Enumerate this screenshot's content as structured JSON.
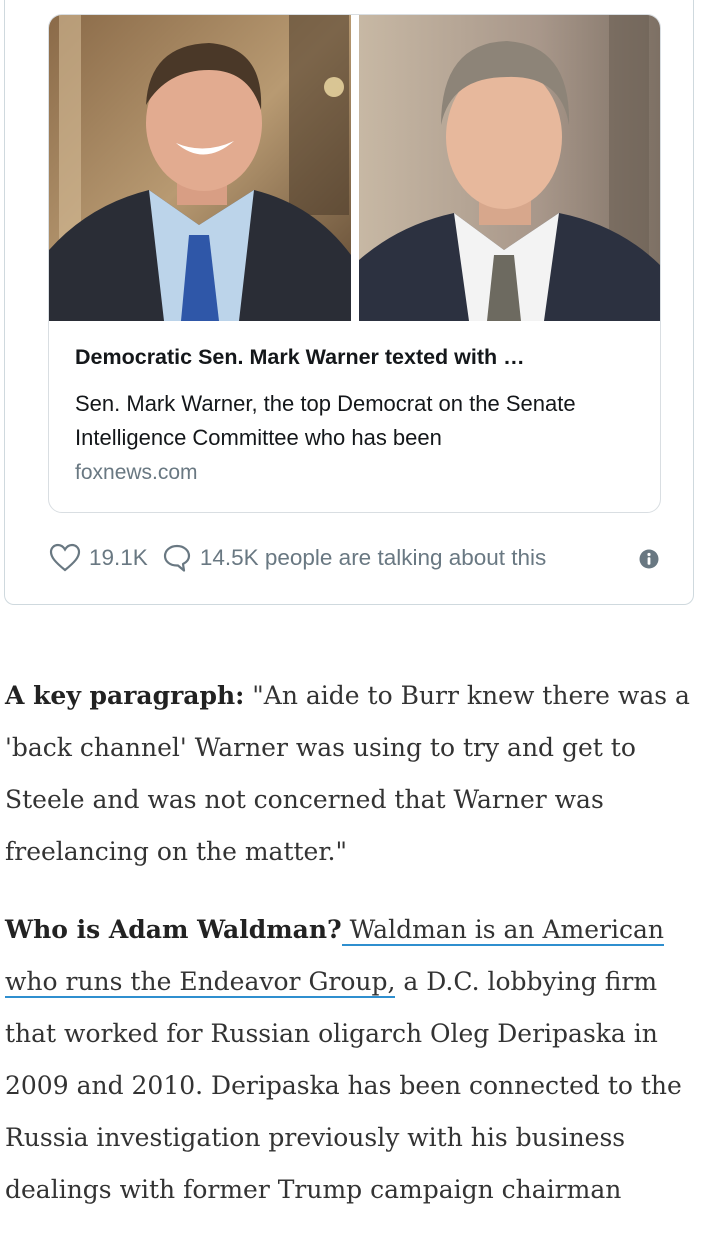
{
  "card": {
    "title": "Democratic Sen. Mark Warner texted with …",
    "description": "Sen. Mark Warner, the top Democrat on the Senate Intelligence Committee who has been",
    "domain": "foxnews.com"
  },
  "engagement": {
    "likes": "19.1K",
    "talking": "14.5K people are talking about this"
  },
  "article": {
    "p1_label": "A key paragraph:",
    "p1_text": " \"An aide to Burr knew there was a 'back channel' Warner was using to try and get to Steele and was not concerned that Warner was freelancing on the matter.\"",
    "p2_label": "Who is Adam Waldman?",
    "p2_link": " Waldman is an American who runs the Endeavor Group,",
    "p2_text": " a D.C. lobbying firm that worked for Russian oligarch Oleg Deripaska in 2009 and 2010. Deripaska has been connected to the Russia investigation previously with his business dealings with former Trump campaign chairman"
  },
  "colors": {
    "text_muted": "#697882",
    "border": "#cfd9de",
    "link_underline": "#2f8fcf"
  },
  "icons": [
    "heart-icon",
    "speech-bubble-icon",
    "info-icon"
  ]
}
